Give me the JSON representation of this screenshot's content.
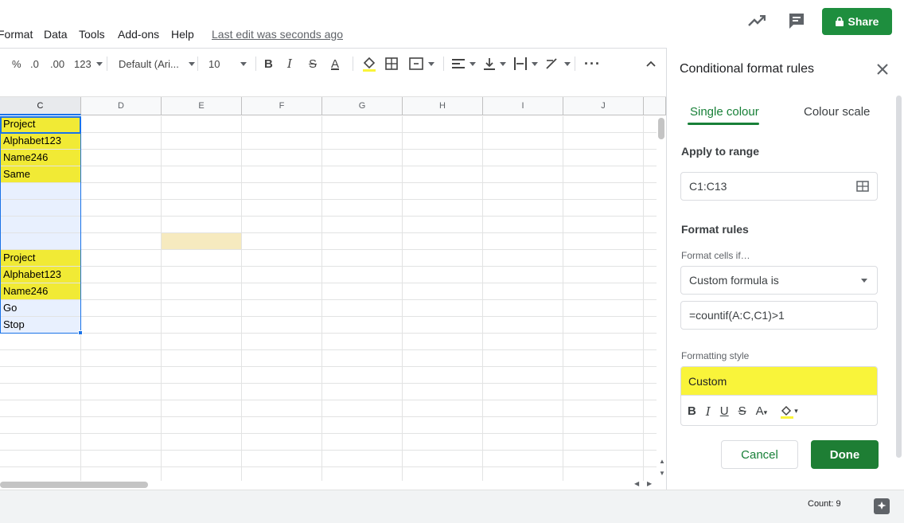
{
  "menu": {
    "items": [
      "Format",
      "Data",
      "Tools",
      "Add-ons",
      "Help"
    ],
    "last_edit": "Last edit was seconds ago",
    "share_label": "Share"
  },
  "toolbar": {
    "percent": "%",
    "decrease_decimal": ".0",
    "increase_decimal": ".00",
    "more_formats": "123",
    "font": "Default (Ari...",
    "font_size": "10"
  },
  "grid": {
    "columns": [
      "C",
      "D",
      "E",
      "F",
      "G",
      "H",
      "I",
      "J"
    ],
    "column_c_cells": [
      "Project",
      "Alphabet123",
      "Name246",
      "Same",
      "",
      "",
      "",
      "",
      "Project",
      "Alphabet123",
      "Name246",
      "Go",
      "Stop"
    ],
    "highlighted_rows": [
      0,
      1,
      2,
      3,
      8,
      9,
      10
    ]
  },
  "status": {
    "count": "Count: 9"
  },
  "panel": {
    "title": "Conditional format rules",
    "tab_single": "Single colour",
    "tab_scale": "Colour scale",
    "apply_range_label": "Apply to range",
    "range_value": "C1:C13",
    "format_rules_label": "Format rules",
    "format_cells_if_label": "Format cells if…",
    "condition_value": "Custom formula is",
    "formula_value": "=countif(A:C,C1)>1",
    "formatting_style_label": "Formatting style",
    "style_preview": "Custom",
    "cancel_label": "Cancel",
    "done_label": "Done"
  },
  "colors": {
    "highlight": "#f1ea35",
    "accent_green": "#188038",
    "selection_blue": "#1a73e8"
  }
}
